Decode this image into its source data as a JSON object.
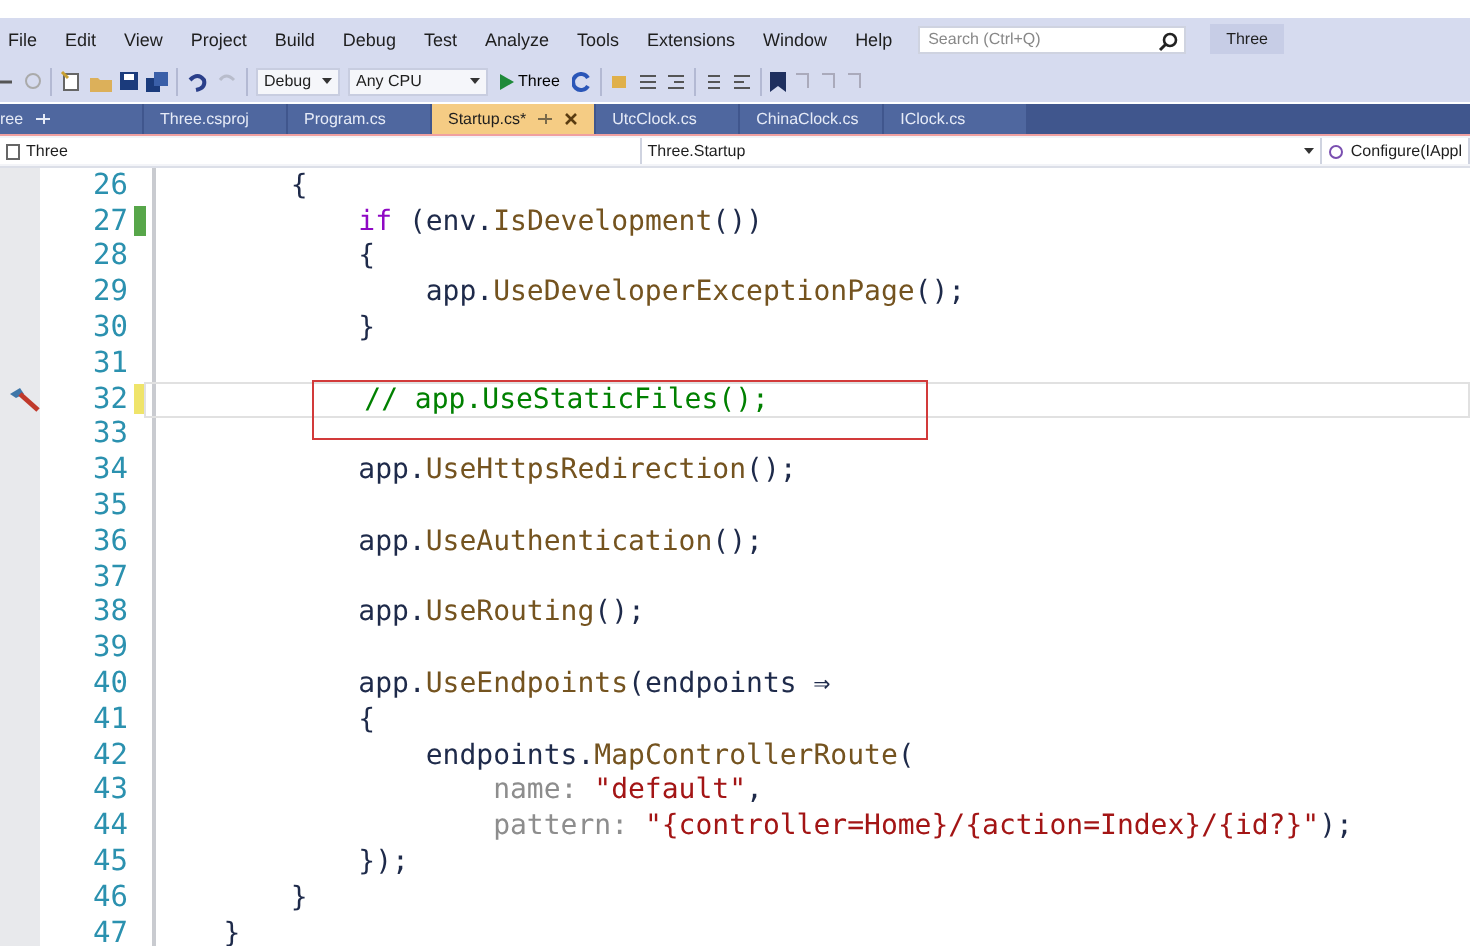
{
  "menu": [
    "File",
    "Edit",
    "View",
    "Project",
    "Build",
    "Debug",
    "Test",
    "Analyze",
    "Tools",
    "Extensions",
    "Window",
    "Help"
  ],
  "search": {
    "placeholder": "Search (Ctrl+Q)"
  },
  "solution_title": "Three",
  "toolbar": {
    "configuration": "Debug",
    "platform": "Any CPU",
    "run_target": "Three"
  },
  "tabs": [
    {
      "label": "ree",
      "pinned": true,
      "selected": false
    },
    {
      "label": "Three.csproj",
      "pinned": false,
      "selected": false
    },
    {
      "label": "Program.cs",
      "pinned": false,
      "selected": false
    },
    {
      "label": "Startup.cs*",
      "pinned": false,
      "selected": true
    },
    {
      "label": "UtcClock.cs",
      "pinned": false,
      "selected": false
    },
    {
      "label": "ChinaClock.cs",
      "pinned": false,
      "selected": false
    },
    {
      "label": "IClock.cs",
      "pinned": false,
      "selected": false
    }
  ],
  "navbar": {
    "project": "Three",
    "type": "Three.Startup",
    "member": "Configure(IAppl"
  },
  "lines": [
    {
      "number": "26",
      "changed": false,
      "current": false,
      "quick_action": false,
      "annotated": false,
      "tokens": [
        {
          "kind": "plain",
          "text": "        {"
        }
      ]
    },
    {
      "number": "27",
      "changed": true,
      "saved": true,
      "current": false,
      "quick_action": false,
      "annotated": false,
      "tokens": [
        {
          "kind": "keyword",
          "text": "            if"
        },
        {
          "kind": "plain",
          "text": " (env."
        },
        {
          "kind": "method",
          "text": "IsDevelopment"
        },
        {
          "kind": "plain",
          "text": "())"
        }
      ]
    },
    {
      "number": "28",
      "changed": false,
      "current": false,
      "quick_action": false,
      "annotated": false,
      "tokens": [
        {
          "kind": "plain",
          "text": "            {"
        }
      ]
    },
    {
      "number": "29",
      "changed": false,
      "current": false,
      "quick_action": false,
      "annotated": false,
      "tokens": [
        {
          "kind": "plain",
          "text": "                app."
        },
        {
          "kind": "method",
          "text": "UseDeveloperExceptionPage"
        },
        {
          "kind": "plain",
          "text": "();"
        }
      ]
    },
    {
      "number": "30",
      "changed": false,
      "current": false,
      "quick_action": false,
      "annotated": false,
      "tokens": [
        {
          "kind": "plain",
          "text": "            }"
        }
      ]
    },
    {
      "number": "31",
      "changed": false,
      "current": false,
      "quick_action": false,
      "annotated": false
    },
    {
      "number": "32",
      "changed": true,
      "saved": false,
      "current": true,
      "quick_action": true,
      "annotated": true,
      "tokens": [
        {
          "kind": "comment",
          "text": "            // app.UseStaticFiles();"
        }
      ]
    },
    {
      "number": "33",
      "changed": false,
      "current": false,
      "quick_action": false,
      "annotated": false
    },
    {
      "number": "34",
      "changed": false,
      "current": false,
      "quick_action": false,
      "annotated": false,
      "tokens": [
        {
          "kind": "plain",
          "text": "            app."
        },
        {
          "kind": "method",
          "text": "UseHttpsRedirection"
        },
        {
          "kind": "plain",
          "text": "();"
        }
      ]
    },
    {
      "number": "35",
      "changed": false,
      "current": false,
      "quick_action": false,
      "annotated": false
    },
    {
      "number": "36",
      "changed": false,
      "current": false,
      "quick_action": false,
      "annotated": false,
      "tokens": [
        {
          "kind": "plain",
          "text": "            app."
        },
        {
          "kind": "method",
          "text": "UseAuthentication"
        },
        {
          "kind": "plain",
          "text": "();"
        }
      ]
    },
    {
      "number": "37",
      "changed": false,
      "current": false,
      "quick_action": false,
      "annotated": false
    },
    {
      "number": "38",
      "changed": false,
      "current": false,
      "quick_action": false,
      "annotated": false,
      "tokens": [
        {
          "kind": "plain",
          "text": "            app."
        },
        {
          "kind": "method",
          "text": "UseRouting"
        },
        {
          "kind": "plain",
          "text": "();"
        }
      ]
    },
    {
      "number": "39",
      "changed": false,
      "current": false,
      "quick_action": false,
      "annotated": false
    },
    {
      "number": "40",
      "changed": false,
      "current": false,
      "quick_action": false,
      "annotated": false,
      "tokens": [
        {
          "kind": "plain",
          "text": "            app."
        },
        {
          "kind": "method",
          "text": "UseEndpoints"
        },
        {
          "kind": "plain",
          "text": "(endpoints ⇒"
        }
      ]
    },
    {
      "number": "41",
      "changed": false,
      "current": false,
      "quick_action": false,
      "annotated": false,
      "tokens": [
        {
          "kind": "plain",
          "text": "            {"
        }
      ]
    },
    {
      "number": "42",
      "changed": false,
      "current": false,
      "quick_action": false,
      "annotated": false,
      "tokens": [
        {
          "kind": "plain",
          "text": "                endpoints."
        },
        {
          "kind": "method",
          "text": "MapControllerRoute"
        },
        {
          "kind": "plain",
          "text": "("
        }
      ]
    },
    {
      "number": "43",
      "changed": false,
      "current": false,
      "quick_action": false,
      "annotated": false,
      "tokens": [
        {
          "kind": "param",
          "text": "                    name:"
        },
        {
          "kind": "string",
          "text": " \"default\""
        },
        {
          "kind": "plain",
          "text": ","
        }
      ]
    },
    {
      "number": "44",
      "changed": false,
      "current": false,
      "quick_action": false,
      "annotated": false,
      "tokens": [
        {
          "kind": "param",
          "text": "                    pattern:"
        },
        {
          "kind": "string",
          "text": " \"{controller=Home}/{action=Index}/{id?}\""
        },
        {
          "kind": "plain",
          "text": ");"
        }
      ]
    },
    {
      "number": "45",
      "changed": false,
      "current": false,
      "quick_action": false,
      "annotated": false,
      "tokens": [
        {
          "kind": "plain",
          "text": "            });"
        }
      ]
    },
    {
      "number": "46",
      "changed": false,
      "current": false,
      "quick_action": false,
      "annotated": false,
      "tokens": [
        {
          "kind": "plain",
          "text": "        }"
        }
      ]
    },
    {
      "number": "47",
      "changed": false,
      "current": false,
      "quick_action": false,
      "annotated": false,
      "tokens": [
        {
          "kind": "plain",
          "text": "    }"
        }
      ]
    }
  ]
}
